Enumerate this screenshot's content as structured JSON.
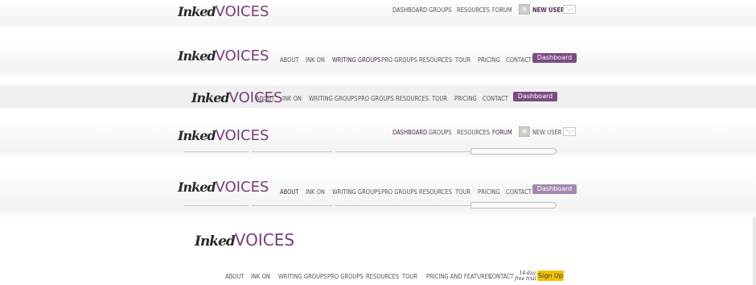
{
  "logo": {
    "inked": "Inked",
    "voices": "VOICES"
  },
  "v1": {
    "nav": [
      "DASHBOARD",
      "GROUPS",
      "RESOURCES",
      "FORUM"
    ],
    "user_label": "NEW USER"
  },
  "v2": {
    "nav": [
      "ABOUT",
      "INK ON",
      "WRITING GROUPS",
      "PRO GROUPS",
      "RESOURCES",
      "TOUR",
      "PRICING",
      "CONTACT"
    ],
    "dashboard_label": "Dashboard"
  },
  "v3": {
    "nav": [
      "ABOUT",
      "INK ON",
      "WRITING GROUPS",
      "PRO GROUPS",
      "RESOURCES",
      "TOUR",
      "PRICING",
      "CONTACT"
    ],
    "dashboard_label": "Dashboard"
  },
  "v4": {
    "nav": [
      "DASHBOARD",
      "GROUPS",
      "RESOURCES",
      "FORUM"
    ],
    "user_label": "NEW USER"
  },
  "v5": {
    "nav": [
      "ABOUT",
      "INK ON",
      "WRITING GROUPS",
      "PRO GROUPS",
      "RESOURCES",
      "TOUR",
      "PRICING",
      "CONTACT"
    ],
    "dashboard_label": "Dashboard"
  },
  "v6": {
    "nav": [
      "ABOUT",
      "INK ON",
      "WRITING GROUPS",
      "PRO GROUPS",
      "RESOURCES",
      "TOUR",
      "PRICING AND FEATURES",
      "CONTACT"
    ],
    "trial_line1": "14-day",
    "trial_line2": "free trial",
    "signup_label": "Sign Up"
  },
  "colors": {
    "brand_purple": "#7a3d7a",
    "dashboard_button": "#7b4a84",
    "signup_button": "#f2c200"
  }
}
